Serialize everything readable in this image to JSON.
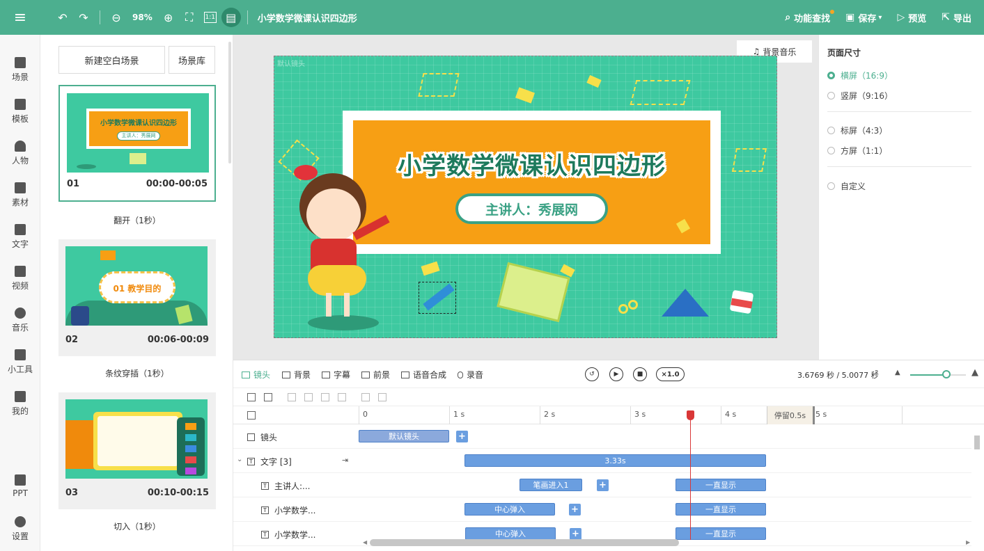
{
  "toolbar": {
    "zoom": "98%",
    "title": "小学数学微课认识四边形",
    "find": "功能查找",
    "save": "保存",
    "preview": "预览",
    "export": "导出",
    "fit_label": "1:1"
  },
  "leftnav": [
    {
      "label": "场景",
      "icon": "scene-icon"
    },
    {
      "label": "模板",
      "icon": "template-icon"
    },
    {
      "label": "人物",
      "icon": "person-icon"
    },
    {
      "label": "素材",
      "icon": "material-icon"
    },
    {
      "label": "文字",
      "icon": "text-icon"
    },
    {
      "label": "视频",
      "icon": "video-icon"
    },
    {
      "label": "音乐",
      "icon": "music-icon"
    },
    {
      "label": "小工具",
      "icon": "toolbox-icon"
    },
    {
      "label": "我的",
      "icon": "my-icon"
    },
    {
      "label": "PPT",
      "icon": "ppt-icon"
    },
    {
      "label": "设置",
      "icon": "settings-icon"
    }
  ],
  "scenes": {
    "new_blank": "新建空白场景",
    "library": "场景库",
    "items": [
      {
        "no": "01",
        "time": "00:00-00:05",
        "transition": "翻开（1秒）",
        "thumb_title": "小学数学微课认识四边形",
        "thumb_sub": "主讲人：秀展网"
      },
      {
        "no": "02",
        "time": "00:06-00:09",
        "transition": "条纹穿插（1秒）",
        "thumb_title": "01  教学目的"
      },
      {
        "no": "03",
        "time": "00:10-00:15",
        "transition": "切入（1秒）"
      }
    ]
  },
  "canvas": {
    "bgm": "背景音乐",
    "title": "小学数学微课认识四边形",
    "speaker": "主讲人：秀展网",
    "corner_label": "默认镜头"
  },
  "props": {
    "heading": "页面尺寸",
    "options": [
      {
        "label": "横屏（16:9）",
        "selected": true
      },
      {
        "label": "竖屏（9:16）",
        "selected": false
      },
      {
        "label": "标屏（4:3）",
        "selected": false
      },
      {
        "label": "方屏（1:1）",
        "selected": false
      },
      {
        "label": "自定义",
        "selected": false
      }
    ]
  },
  "timeline": {
    "tabs": [
      "镜头",
      "背景",
      "字幕",
      "前景",
      "语音合成",
      "录音"
    ],
    "speed": "×1.0",
    "time_readout": "3.6769 秒 / 5.0077 秒",
    "ruler": [
      "0",
      "1 s",
      "2 s",
      "3 s",
      "4 s",
      "5 s"
    ],
    "pause": "停留0.5s",
    "rows": [
      {
        "label": "镜头",
        "clips": [
          "默认镜头"
        ]
      },
      {
        "label": "文字 [3]",
        "clips": [
          "3.33s"
        ]
      },
      {
        "label": "主讲人:...",
        "clips": [
          "笔画进入1",
          "一直显示"
        ]
      },
      {
        "label": "小学数学...",
        "clips": [
          "中心弹入",
          "一直显示"
        ]
      },
      {
        "label": "小学数学...",
        "clips": [
          "中心弹入",
          "一直显示"
        ]
      }
    ]
  },
  "colors": {
    "accent": "#4caf8f",
    "canvas_bg": "#3ec9a0",
    "board": "#f79f14",
    "clip": "#6a9ee0",
    "playhead": "#d93737"
  }
}
